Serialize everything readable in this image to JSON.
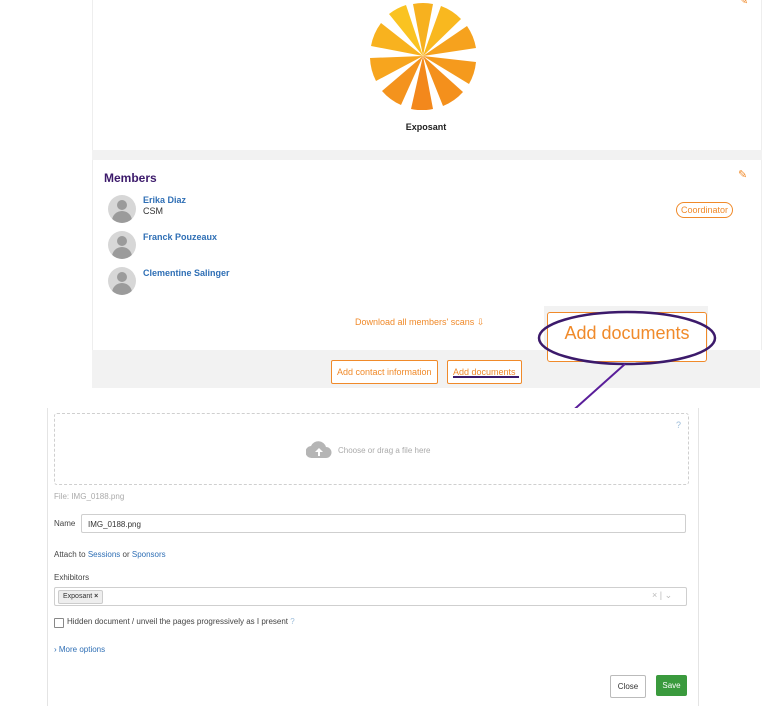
{
  "exhibitor": {
    "name": "Exposant"
  },
  "members": {
    "title": "Members",
    "list": [
      {
        "name": "Erika Diaz",
        "role": "CSM",
        "badge": "Coordinator"
      },
      {
        "name": "Franck Pouzeaux",
        "role": "",
        "badge": ""
      },
      {
        "name": "Clementine Salinger",
        "role": "",
        "badge": ""
      }
    ],
    "download_label": "Download all members' scans"
  },
  "actions": {
    "add_contact_label": "Add contact information",
    "add_documents_label": "Add documents"
  },
  "callout": {
    "label": "Add documents"
  },
  "upload": {
    "dropzone_text": "Choose or drag a file here",
    "help_icon": "?",
    "file_label": "File: IMG_0188.png",
    "name_label": "Name",
    "name_value": "IMG_0188.png",
    "attach_prefix": "Attach to",
    "attach_sessions": "Sessions",
    "attach_or": "or",
    "attach_sponsors": "Sponsors",
    "exhibitors_label": "Exhibitors",
    "exhibitor_tag": "Exposant",
    "tag_remove": "×",
    "clear": "×",
    "separator": "|",
    "dropdown": "⌄",
    "hidden_doc_label": "Hidden document / unveil the pages progressively as I present",
    "more_options": "› More options",
    "close_label": "Close",
    "save_label": "Save"
  },
  "colors": {
    "accent": "#f08a2a",
    "link": "#2f6fb5",
    "heading": "#3c1a6b",
    "save": "#3a9a3d"
  }
}
